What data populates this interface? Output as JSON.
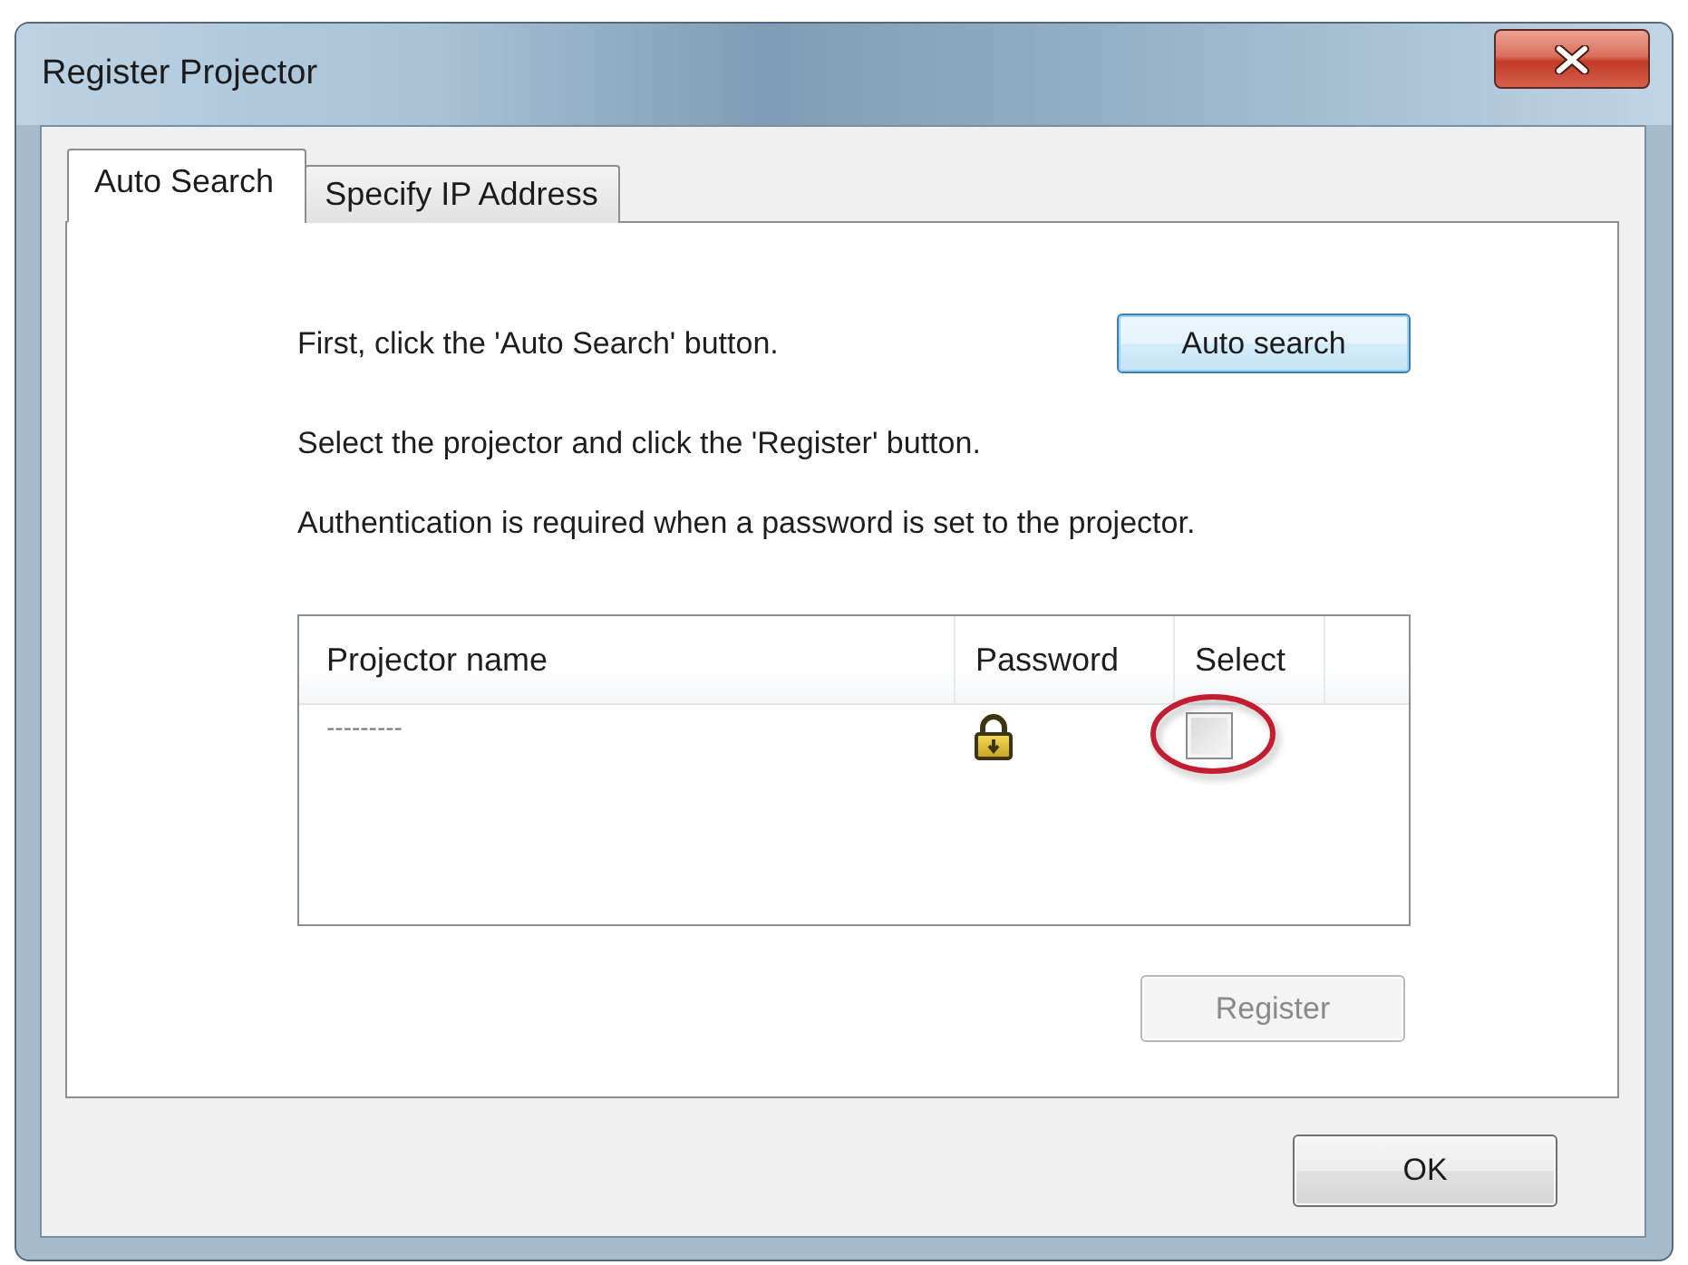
{
  "window": {
    "title": "Register Projector"
  },
  "tabs": [
    {
      "label": "Auto Search",
      "selected": true
    },
    {
      "label": "Specify IP Address",
      "selected": false
    }
  ],
  "instructions": [
    "First, click the 'Auto Search' button.",
    "Select the projector and click the 'Register' button.",
    "Authentication is required when a password is set to the projector."
  ],
  "auto_search_button": {
    "label": "Auto search",
    "focused": true,
    "disabled": false
  },
  "projector_list": {
    "columns": [
      "Projector name",
      "Password",
      "Select"
    ],
    "rows": [
      {
        "name": "---------",
        "password_set": true,
        "checked": false,
        "highlighted": true
      }
    ]
  },
  "register_button": {
    "label": "Register",
    "focused": false,
    "disabled": true
  },
  "ok_button": {
    "label": "OK",
    "focused": false,
    "disabled": false
  }
}
